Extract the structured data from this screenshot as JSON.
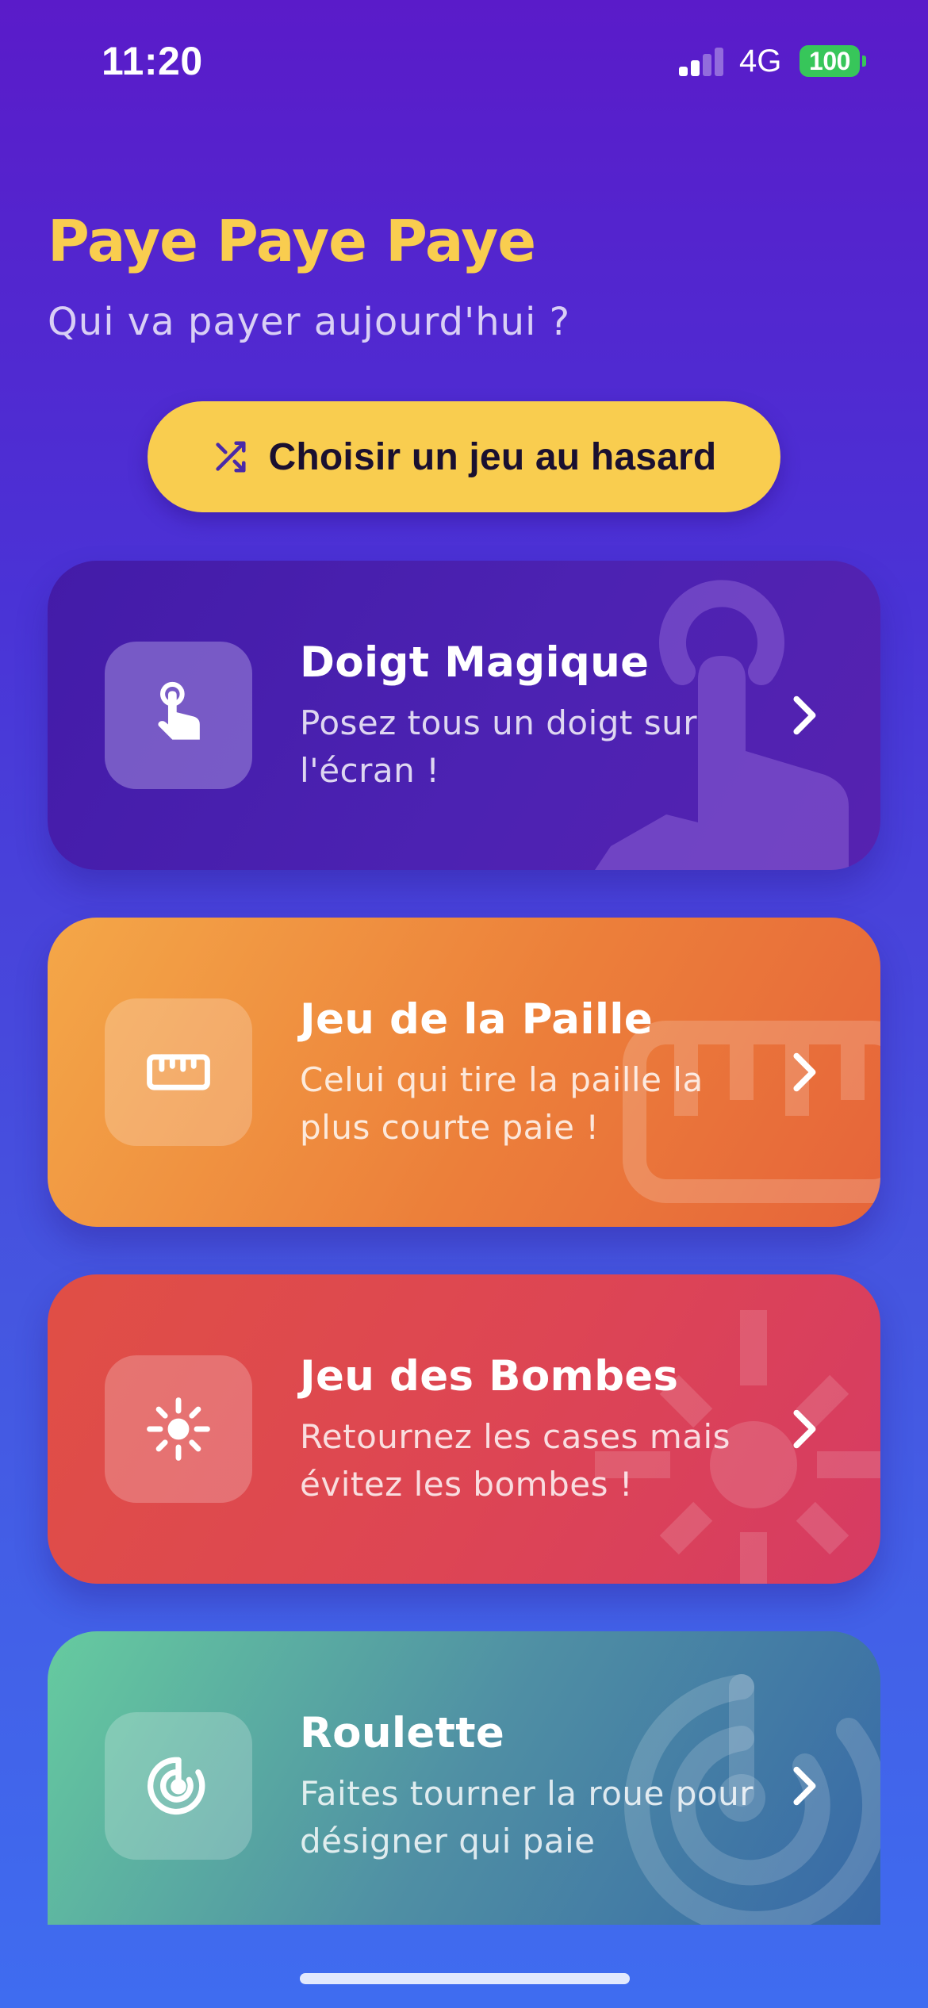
{
  "status_bar": {
    "time": "11:20",
    "network": "4G",
    "battery": "100",
    "signal_bars_active": 2,
    "signal_bars_total": 4
  },
  "header": {
    "title": "Paye Paye Paye",
    "subtitle": "Qui va payer aujourd'hui ?"
  },
  "random_button": {
    "label": "Choisir un jeu au hasard",
    "icon": "shuffle-icon"
  },
  "games": [
    {
      "title": "Doigt Magique",
      "description": "Posez tous un doigt sur l'écran !",
      "icon": "finger-tap-icon",
      "gradient": [
        "#431ba8",
        "#5622b0"
      ]
    },
    {
      "title": "Jeu de la Paille",
      "description": "Celui qui tire la paille la plus courte paie !",
      "icon": "ruler-icon",
      "gradient": [
        "#f4a748",
        "#e6643a"
      ]
    },
    {
      "title": "Jeu des Bombes",
      "description": "Retournez les cases mais évitez les bombes !",
      "icon": "bomb-burst-icon",
      "gradient": [
        "#e04f45",
        "#d63b63"
      ]
    },
    {
      "title": "Roulette",
      "description": "Faites tourner la roue pour désigner qui paie",
      "icon": "roulette-icon",
      "gradient": [
        "#66cb9f",
        "#3768a6"
      ]
    }
  ],
  "colors": {
    "accent": "#f9cd4f",
    "background_top": "#5a1bc9",
    "background_bottom": "#3f6cf0"
  }
}
